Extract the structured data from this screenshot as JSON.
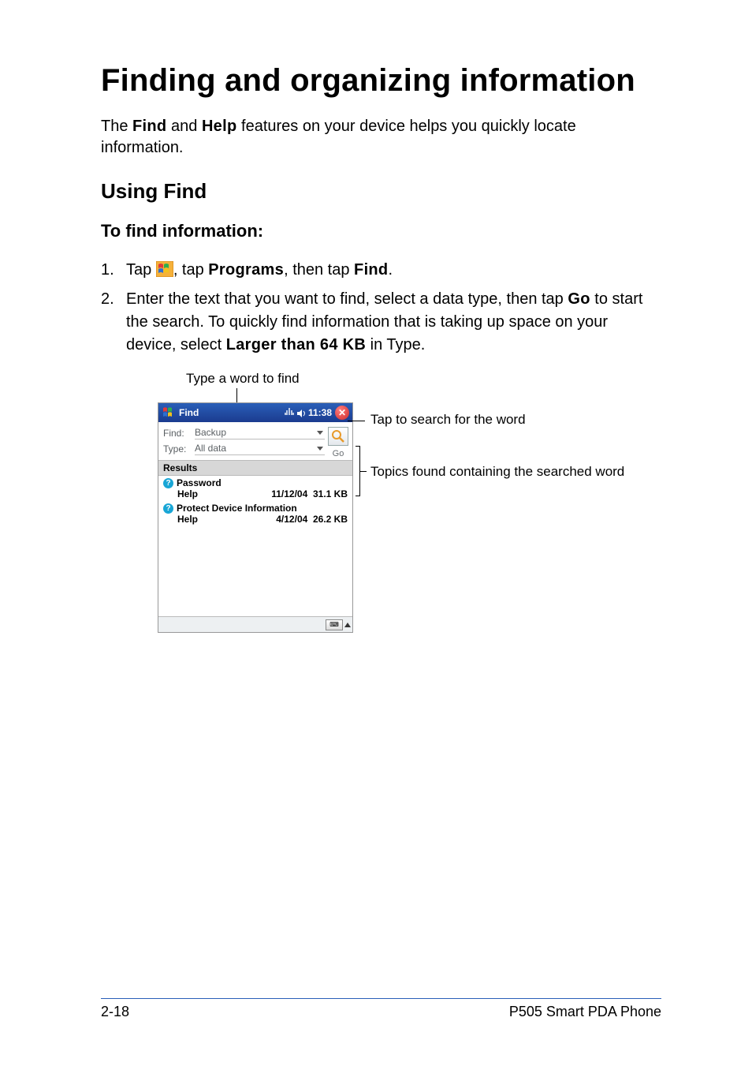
{
  "page": {
    "title": "Finding and organizing information",
    "intro_pre": "The ",
    "find": "Find",
    "intro_mid": " and ",
    "help": "Help",
    "intro_post": " features on your device helps you quickly locate information."
  },
  "section": {
    "h2": "Using Find",
    "h3": "To find information:",
    "step1_pre": "Tap ",
    "step1_mid": ", tap ",
    "programs": "Programs",
    "step1_mid2": ", then tap ",
    "find": "Find",
    "step1_end": ".",
    "step2_pre": "Enter the text that you want to find, select a data type, then tap ",
    "go": "Go",
    "step2_mid": " to start the search. To quickly find information that is taking up space on your device, select ",
    "larger": "Larger than 64 KB",
    "step2_end": " in Type."
  },
  "callouts": {
    "top": "Type a word to find",
    "go": "Tap to search for the word",
    "results": "Topics found containing the searched word"
  },
  "pda": {
    "title": "Find",
    "time": "11:38",
    "find_label": "Find:",
    "find_value": "Backup",
    "type_label": "Type:",
    "type_value": "All data",
    "go": "Go",
    "results_header": "Results",
    "results": [
      {
        "name": "Password",
        "source": "Help",
        "date": "11/12/04",
        "size": "31.1 KB"
      },
      {
        "name": "Protect Device Information",
        "source": "Help",
        "date": "4/12/04",
        "size": "26.2 KB"
      }
    ]
  },
  "footer": {
    "left": "2-18",
    "right": "P505 Smart PDA Phone"
  }
}
